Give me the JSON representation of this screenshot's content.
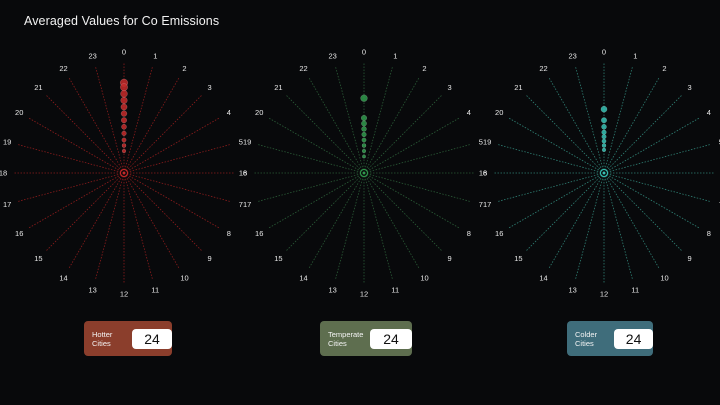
{
  "title": "Averaged Values for Co Emissions",
  "hours": [
    "0",
    "1",
    "2",
    "3",
    "4",
    "5",
    "6",
    "7",
    "8",
    "9",
    "10",
    "11",
    "12",
    "13",
    "14",
    "15",
    "16",
    "17",
    "18",
    "19",
    "20",
    "21",
    "22",
    "23"
  ],
  "cards": [
    {
      "label": "Hotter\nCities",
      "value": "24",
      "color": "#8b3e2c"
    },
    {
      "label": "Temperate\nCities",
      "value": "24",
      "color": "#5e6e4f"
    },
    {
      "label": "Colder\nCities",
      "value": "24",
      "color": "#3f6d7b"
    }
  ],
  "chart_data": [
    {
      "type": "radial-scatter",
      "group": "Hotter Cities",
      "color": "#c42a2a",
      "spoke_color": "#8a1c1c",
      "angular_axis": "hour 0-23",
      "points": [
        {
          "hour": 0,
          "r": 0.82
        },
        {
          "hour": 0,
          "r": 0.78
        },
        {
          "hour": 0,
          "r": 0.72
        },
        {
          "hour": 0,
          "r": 0.66
        },
        {
          "hour": 0,
          "r": 0.6
        },
        {
          "hour": 0,
          "r": 0.54
        },
        {
          "hour": 0,
          "r": 0.48
        },
        {
          "hour": 0,
          "r": 0.42
        },
        {
          "hour": 0,
          "r": 0.36
        },
        {
          "hour": 0,
          "r": 0.3
        },
        {
          "hour": 0,
          "r": 0.25
        },
        {
          "hour": 0,
          "r": 0.2
        }
      ]
    },
    {
      "type": "radial-scatter",
      "group": "Temperate Cities",
      "color": "#2f9a4c",
      "spoke_color": "#2a5a36",
      "angular_axis": "hour 0-23",
      "points": [
        {
          "hour": 0,
          "r": 0.68
        },
        {
          "hour": 0,
          "r": 0.5
        },
        {
          "hour": 0,
          "r": 0.45
        },
        {
          "hour": 0,
          "r": 0.4
        },
        {
          "hour": 0,
          "r": 0.35
        },
        {
          "hour": 0,
          "r": 0.3
        },
        {
          "hour": 0,
          "r": 0.25
        },
        {
          "hour": 0,
          "r": 0.2
        },
        {
          "hour": 0,
          "r": 0.15
        }
      ]
    },
    {
      "type": "radial-scatter",
      "group": "Colder Cities",
      "color": "#35c1b4",
      "spoke_color": "#2f7f73",
      "angular_axis": "hour 0-23",
      "points": [
        {
          "hour": 0,
          "r": 0.58
        },
        {
          "hour": 0,
          "r": 0.48
        },
        {
          "hour": 0,
          "r": 0.42
        },
        {
          "hour": 0,
          "r": 0.37
        },
        {
          "hour": 0,
          "r": 0.33
        },
        {
          "hour": 0,
          "r": 0.29
        },
        {
          "hour": 0,
          "r": 0.25
        },
        {
          "hour": 0,
          "r": 0.21
        }
      ]
    }
  ]
}
